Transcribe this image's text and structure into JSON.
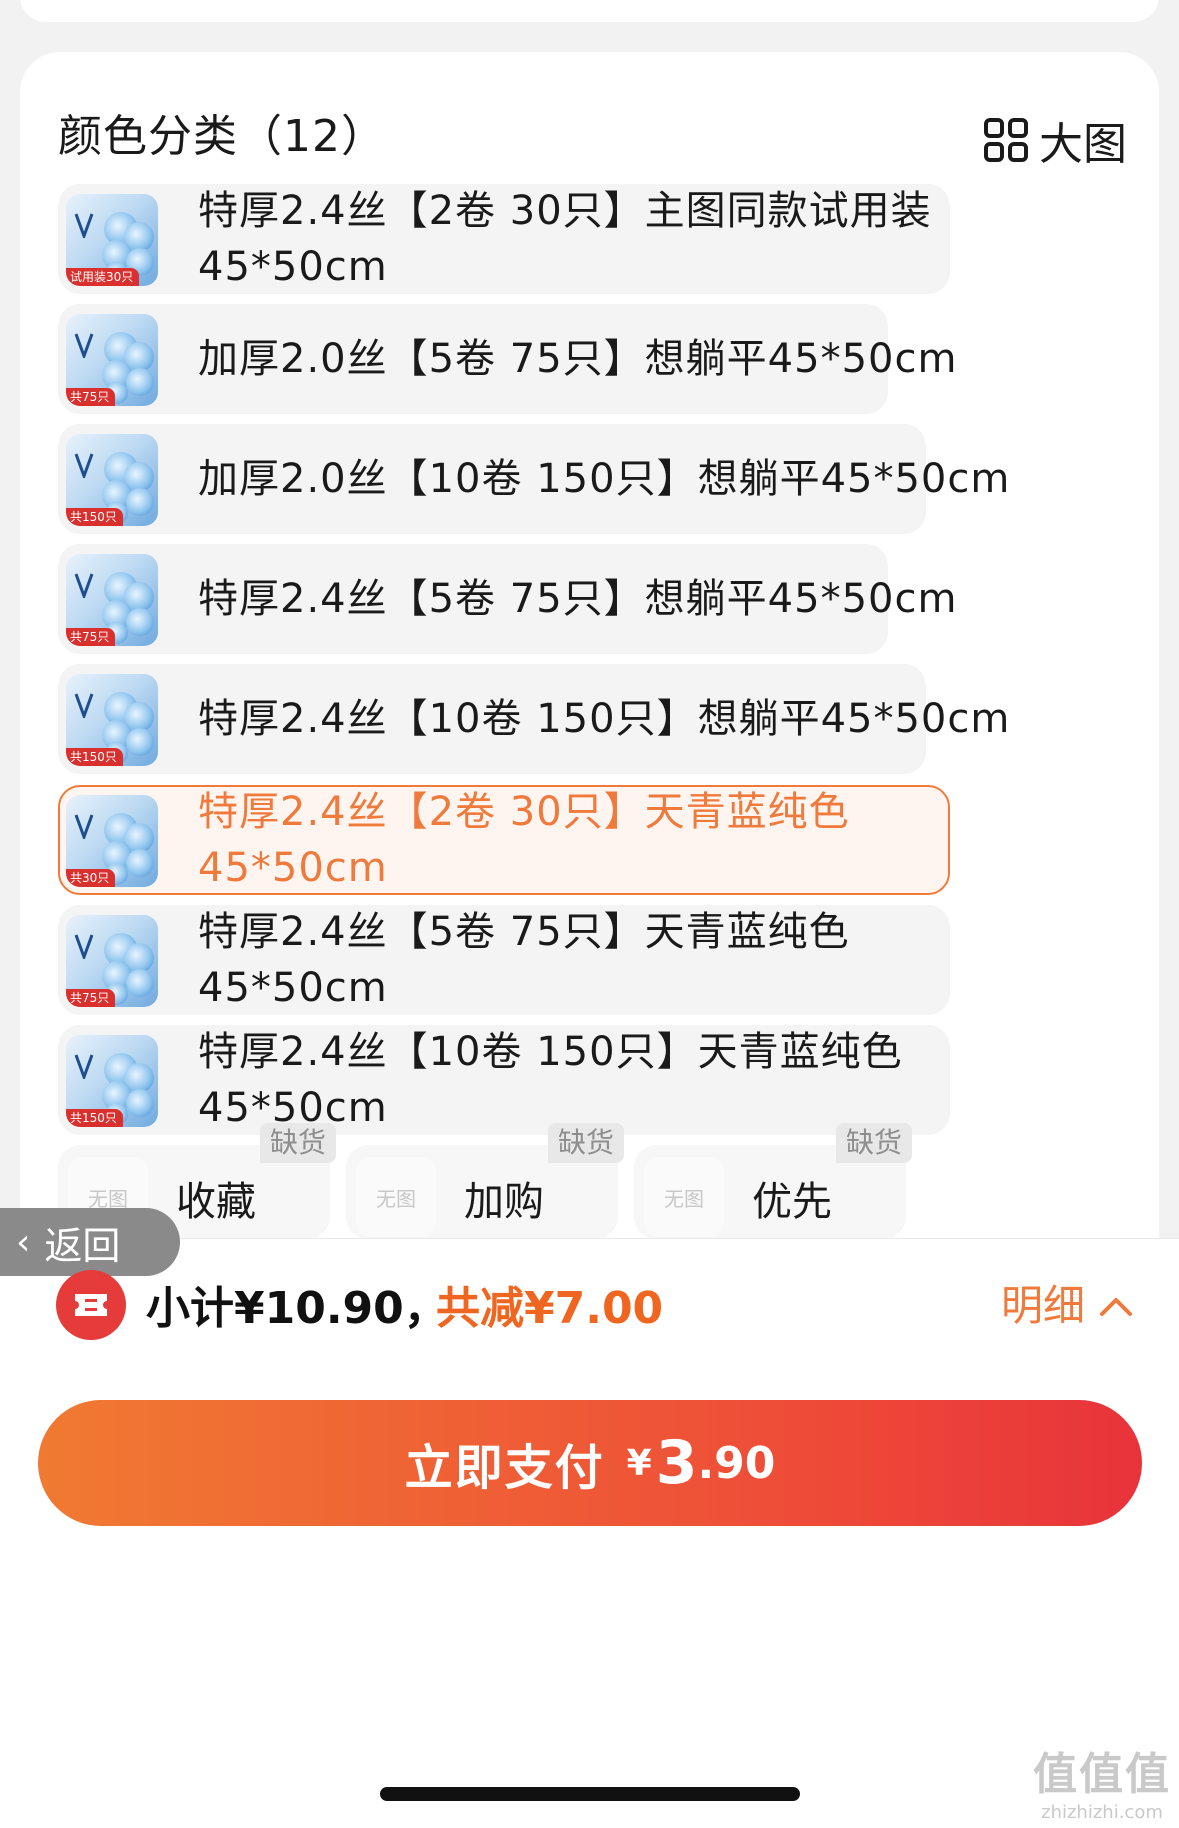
{
  "header": {
    "title": "颜色分类（12）",
    "view_label": "大图"
  },
  "items": [
    {
      "line1": "特厚2.4丝【2卷 30只】主图同款试用装",
      "line2": "45*50cm",
      "tag": "试用装30只",
      "selected": false
    },
    {
      "line1": "加厚2.0丝【5卷 75只】想躺平45*50cm",
      "line2": "",
      "tag": "共75只",
      "selected": false
    },
    {
      "line1": "加厚2.0丝【10卷 150只】想躺平45*50cm",
      "line2": "",
      "tag": "共150只",
      "selected": false
    },
    {
      "line1": "特厚2.4丝【5卷 75只】想躺平45*50cm",
      "line2": "",
      "tag": "共75只",
      "selected": false
    },
    {
      "line1": "特厚2.4丝【10卷 150只】想躺平45*50cm",
      "line2": "",
      "tag": "共150只",
      "selected": false
    },
    {
      "line1": "特厚2.4丝【2卷 30只】天青蓝纯色",
      "line2": "45*50cm",
      "tag": "共30只",
      "selected": true
    },
    {
      "line1": "特厚2.4丝【5卷 75只】天青蓝纯色",
      "line2": "45*50cm",
      "tag": "共75只",
      "selected": false
    },
    {
      "line1": "特厚2.4丝【10卷 150只】天青蓝纯色",
      "line2": "45*50cm",
      "tag": "共150只",
      "selected": false
    }
  ],
  "out_of_stock": [
    {
      "label": "收藏",
      "badge": "缺货",
      "placeholder": "无图"
    },
    {
      "label": "加购",
      "badge": "缺货",
      "placeholder": "无图"
    },
    {
      "label": "优先",
      "badge": "缺货",
      "placeholder": "无图"
    }
  ],
  "back": {
    "label": "返回"
  },
  "footer": {
    "subtotal": "小计¥10.90，",
    "saved": "共减¥7.00",
    "detail_label": "明细",
    "pay_label": "立即支付",
    "pay_currency": "¥",
    "pay_integer": "3",
    "pay_decimal": ".90"
  },
  "watermark": {
    "main": "值值值",
    "sub": "zhizhizhi.com"
  },
  "colors": {
    "accent": "#f07a3c",
    "pay_gradient_start": "#f07a32",
    "pay_gradient_end": "#e8333a",
    "coupon": "#e53b3b"
  }
}
